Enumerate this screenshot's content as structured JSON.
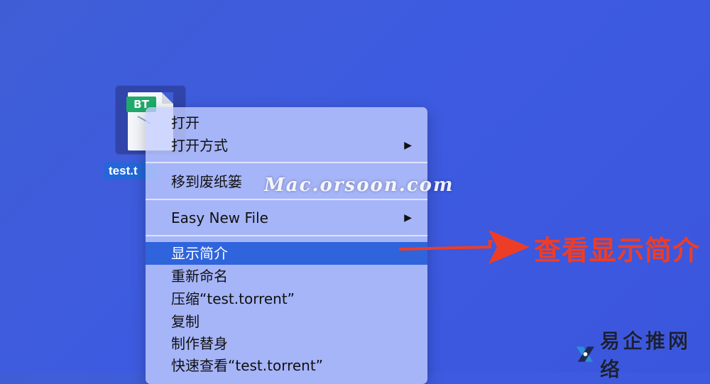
{
  "desktop": {
    "file": {
      "badge": "BT",
      "label": "test.t"
    }
  },
  "context_menu": {
    "items": [
      {
        "label": "打开",
        "has_submenu": false
      },
      {
        "label": "打开方式",
        "has_submenu": true,
        "arrow": "▶"
      },
      {
        "label": "移到废纸篓",
        "has_submenu": false
      },
      {
        "label": "Easy New File",
        "has_submenu": true,
        "arrow": "▶"
      },
      {
        "label": "显示简介",
        "has_submenu": false,
        "highlighted": true
      },
      {
        "label": "重新命名",
        "has_submenu": false
      },
      {
        "label": "压缩“test.torrent”",
        "has_submenu": false
      },
      {
        "label": "复制",
        "has_submenu": false
      },
      {
        "label": "制作替身",
        "has_submenu": false
      },
      {
        "label": "快速查看“test.torrent”",
        "has_submenu": false
      }
    ]
  },
  "watermark": "Mac.orsoon.com",
  "annotation": {
    "text": "查看显示简介",
    "color": "#ee3d26"
  },
  "brand": {
    "text": "易企推网络",
    "icon": "brand-logo-icon"
  },
  "colors": {
    "desktop_bg": "#3f5ed6",
    "menu_highlight": "#2f64dc",
    "file_label_bg": "#2367d8"
  }
}
